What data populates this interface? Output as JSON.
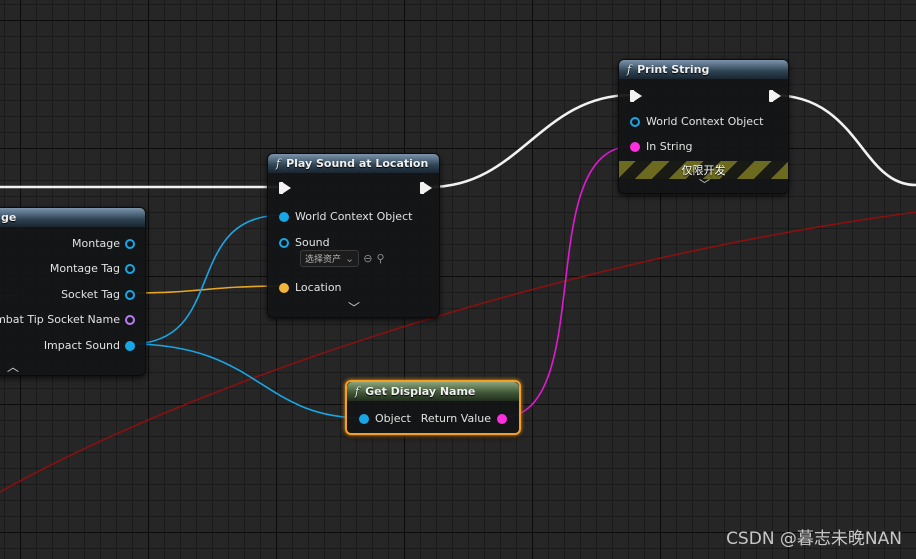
{
  "colors": {
    "exec": "#f2f2f2",
    "object_pin": "#17a7e8",
    "string_pin": "#ff2ee0",
    "name_pin": "#f2b43a",
    "soft_ref_pin": "#b77cf2",
    "stripe": "#6b6a1e",
    "selection": "#f6a021",
    "red_wire": "#8a1010"
  },
  "left_node": {
    "title_fragment": "ge",
    "pins": [
      {
        "label": "Montage",
        "icon": "hollow-blue-pin"
      },
      {
        "label": "Montage Tag",
        "icon": "hollow-blue-pin"
      },
      {
        "label": "Socket Tag",
        "icon": "hollow-blue-pin"
      },
      {
        "label": "Combat Tip Socket Name",
        "icon": "hollow-purple-pin"
      },
      {
        "label": "Impact Sound",
        "icon": "filled-blue-pin"
      }
    ],
    "collapse_icon": "chevron-up-icon"
  },
  "play_sound": {
    "title": "Play Sound at Location",
    "fn_icon": "f",
    "pins": {
      "world_context": "World Context Object",
      "sound": "Sound",
      "location": "Location"
    },
    "asset_select": "选择资产",
    "expand_icon": "chevron-down-icon"
  },
  "print_string": {
    "title": "Print String",
    "fn_icon": "f",
    "pins": {
      "world_context": "World Context Object",
      "in_string": "In String"
    },
    "dev_only": "仅限开发",
    "expand_icon": "chevron-down-icon"
  },
  "get_display_name": {
    "title": "Get Display Name",
    "fn_icon": "f",
    "input": "Object",
    "output": "Return Value"
  },
  "watermark": "CSDN @暮志未晚NAN"
}
